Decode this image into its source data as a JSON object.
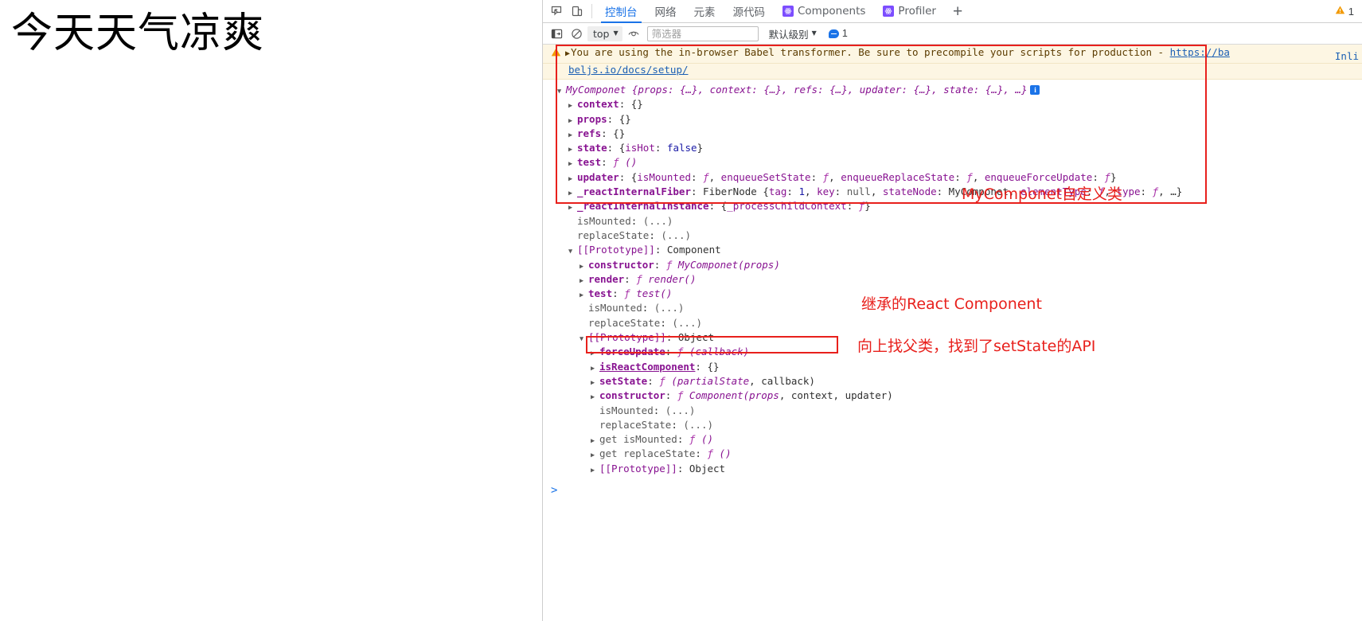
{
  "page": {
    "heading": "今天天气凉爽"
  },
  "devtools": {
    "tabbar": {
      "inspect_icon": "inspect-element-icon",
      "device_icon": "device-toolbar-icon",
      "tabs": [
        {
          "label": "控制台",
          "active": true,
          "react": false
        },
        {
          "label": "网络",
          "active": false,
          "react": false
        },
        {
          "label": "元素",
          "active": false,
          "react": false
        },
        {
          "label": "源代码",
          "active": false,
          "react": false
        },
        {
          "label": "Components",
          "active": false,
          "react": true
        },
        {
          "label": "Profiler",
          "active": false,
          "react": true
        }
      ],
      "add_tab_label": "+",
      "warning_count": "1"
    },
    "filterbar": {
      "sidebar_toggle_icon": "show-console-sidebar-icon",
      "clear_icon": "clear-console-icon",
      "context_value": "top",
      "eye_icon": "live-expression-icon",
      "filter_placeholder": "筛选器",
      "filter_value": "",
      "level_label": "默认级别",
      "message_count": "1"
    },
    "warning": {
      "text_before_link": "You are using the in-browser Babel transformer. Be sure to precompile your scripts for production - ",
      "link_part1": "https://ba",
      "link_part2": "beljs.io/docs/setup/",
      "right_label": "Inli"
    },
    "tree": [
      {
        "indent": 0,
        "arrow": "open",
        "content_id": "root"
      },
      {
        "indent": 1,
        "arrow": "closed",
        "content_id": "context"
      },
      {
        "indent": 1,
        "arrow": "closed",
        "content_id": "props"
      },
      {
        "indent": 1,
        "arrow": "closed",
        "content_id": "refs"
      },
      {
        "indent": 1,
        "arrow": "closed",
        "content_id": "state"
      },
      {
        "indent": 1,
        "arrow": "closed",
        "content_id": "test"
      },
      {
        "indent": 1,
        "arrow": "closed",
        "content_id": "updater"
      },
      {
        "indent": 1,
        "arrow": "closed",
        "content_id": "fiber"
      },
      {
        "indent": 1,
        "arrow": "closed",
        "content_id": "instance"
      },
      {
        "indent": 1,
        "arrow": "none",
        "content_id": "isMounted1"
      },
      {
        "indent": 1,
        "arrow": "none",
        "content_id": "replaceState1"
      },
      {
        "indent": 1,
        "arrow": "open",
        "content_id": "protoComponent"
      },
      {
        "indent": 2,
        "arrow": "closed",
        "content_id": "constructorMy"
      },
      {
        "indent": 2,
        "arrow": "closed",
        "content_id": "render"
      },
      {
        "indent": 2,
        "arrow": "closed",
        "content_id": "test2"
      },
      {
        "indent": 2,
        "arrow": "none",
        "content_id": "isMounted2"
      },
      {
        "indent": 2,
        "arrow": "none",
        "content_id": "replaceState2"
      },
      {
        "indent": 2,
        "arrow": "open",
        "content_id": "protoObject"
      },
      {
        "indent": 3,
        "arrow": "closed",
        "content_id": "forceUpdate"
      },
      {
        "indent": 3,
        "arrow": "closed",
        "content_id": "isReactComponent"
      },
      {
        "indent": 3,
        "arrow": "closed",
        "content_id": "setState"
      },
      {
        "indent": 3,
        "arrow": "closed",
        "content_id": "constructorComponent"
      },
      {
        "indent": 3,
        "arrow": "none",
        "content_id": "isMounted3"
      },
      {
        "indent": 3,
        "arrow": "none",
        "content_id": "replaceState3"
      },
      {
        "indent": 3,
        "arrow": "closed",
        "content_id": "getIsMounted"
      },
      {
        "indent": 3,
        "arrow": "closed",
        "content_id": "getReplaceState"
      },
      {
        "indent": 3,
        "arrow": "closed",
        "content_id": "protoObject2"
      }
    ],
    "tree_text": {
      "root": "MyComponet {props: {…}, context: {…}, refs: {…}, updater: {…}, state: {…}, …}",
      "context": "context: {}",
      "props": "props: {}",
      "refs": "refs: {}",
      "state": "state: {isHot: false}",
      "test": "test: ƒ ()",
      "updater": "updater: {isMounted: ƒ, enqueueSetState: ƒ, enqueueReplaceState: ƒ, enqueueForceUpdate: ƒ}",
      "fiber": "_reactInternalFiber: FiberNode {tag: 1, key: null, stateNode: MyComponet, elementType: ƒ, type: ƒ, …}",
      "instance": "_reactInternalInstance: {_processChildContext: ƒ}",
      "isMounted1": "isMounted: (...)",
      "replaceState1": "replaceState: (...)",
      "protoComponent": "[[Prototype]]: Component",
      "constructorMy": "constructor: ƒ MyComponet(props)",
      "render": "render: ƒ render()",
      "test2": "test: ƒ test()",
      "isMounted2": "isMounted: (...)",
      "replaceState2": "replaceState: (...)",
      "protoObject": "[[Prototype]]: Object",
      "forceUpdate": "forceUpdate: ƒ (callback)",
      "isReactComponent": "isReactComponent: {}",
      "setState": "setState: ƒ (partialState, callback)",
      "constructorComponent": "constructor: ƒ Component(props, context, updater)",
      "isMounted3": "isMounted: (...)",
      "replaceState3": "replaceState: (...)",
      "getIsMounted": "get isMounted: ƒ ()",
      "getReplaceState": "get replaceState: ƒ ()",
      "protoObject2": "[[Prototype]]: Object"
    },
    "prompt_symbol": ">",
    "annotations": [
      {
        "id": "anno-my-component",
        "text": "MyComponet自定义类"
      },
      {
        "id": "anno-react-component",
        "text": "继承的React Component"
      },
      {
        "id": "anno-set-state",
        "text": "向上找父类，找到了setState的API"
      }
    ]
  },
  "colors": {
    "accent_blue": "#1a73e8",
    "annotation_red": "#e8201c",
    "warning_bg": "#fdf6e3",
    "react_purple": "#7c4dff",
    "key_purple": "#881391"
  }
}
